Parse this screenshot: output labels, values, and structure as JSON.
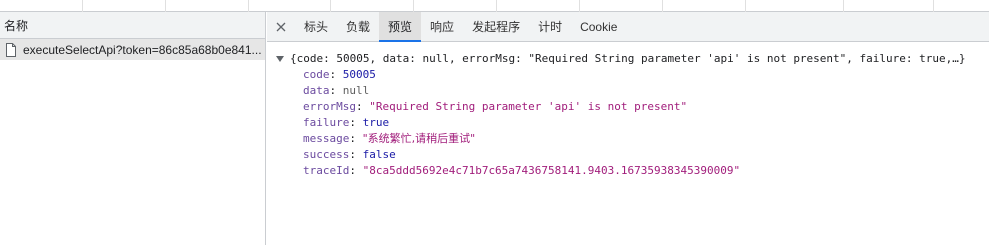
{
  "left_panel": {
    "header": "名称",
    "request_name": "executeSelectApi?token=86c85a68b0e841..."
  },
  "tabs": [
    "标头",
    "负载",
    "预览",
    "响应",
    "发起程序",
    "计时",
    "Cookie"
  ],
  "active_tab": "预览",
  "preview": {
    "summary": "{code: 50005, data: null, errorMsg: \"Required String parameter 'api' is not present\", failure: true,…}",
    "properties": [
      {
        "key": "code",
        "value": "50005",
        "type": "num"
      },
      {
        "key": "data",
        "value": "null",
        "type": "nul"
      },
      {
        "key": "errorMsg",
        "value": "\"Required String parameter 'api' is not present\"",
        "type": "str"
      },
      {
        "key": "failure",
        "value": "true",
        "type": "bool"
      },
      {
        "key": "message",
        "value": "\"系统繁忙,请稍后重试\"",
        "type": "str"
      },
      {
        "key": "success",
        "value": "false",
        "type": "bool"
      },
      {
        "key": "traceId",
        "value": "\"8ca5ddd5692e4c71b7c65a7436758141.9403.16735938345390009\"",
        "type": "str"
      }
    ]
  },
  "icons": {
    "close": "close-icon",
    "file": "file-icon",
    "expand": "triangle-down-icon"
  },
  "colors": {
    "key": "#6b4a9f",
    "number": "#1a1aa6",
    "string": "#a11d7b",
    "active_tab_underline": "#1a73e8"
  }
}
